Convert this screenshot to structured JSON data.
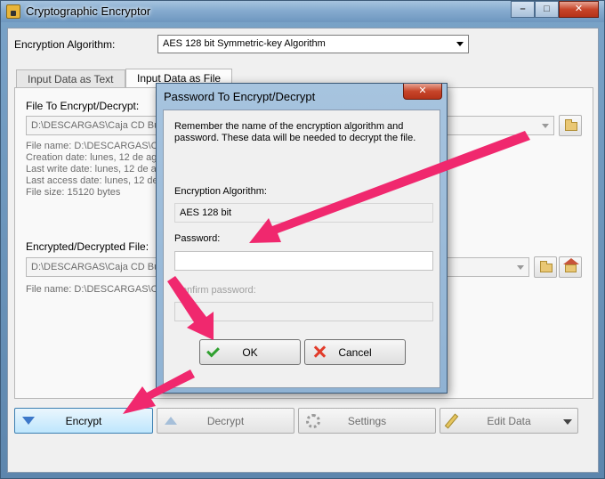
{
  "window": {
    "title": "Cryptographic Encryptor",
    "minimize": "–",
    "maximize": "□",
    "close": "✕"
  },
  "top": {
    "algorithm_label": "Encryption Algorithm:",
    "algorithm_value": "AES 128 bit Symmetric-key Algorithm"
  },
  "tabs": [
    {
      "label": "Input Data as Text",
      "active": false
    },
    {
      "label": "Input Data as File",
      "active": true
    }
  ],
  "source": {
    "label": "File To Encrypt/Decrypt:",
    "path": "D:\\DESCARGAS\\Caja CD Bur",
    "info": [
      "File name: D:\\DESCARGAS\\Caj",
      "Creation date: lunes, 12 de ago",
      "Last write date: lunes, 12 de ag",
      "Last access date: lunes, 12 de",
      "File size: 15120 bytes"
    ]
  },
  "dest": {
    "label": "Encrypted/Decrypted File:",
    "path": "D:\\DESCARGAS\\Caja CD Bur",
    "info": "File name: D:\\DESCARGAS\\Ca"
  },
  "buttons": {
    "encrypt": "Encrypt",
    "decrypt": "Decrypt",
    "settings": "Settings",
    "edit_data": "Edit Data"
  },
  "dialog": {
    "title": "Password To Encrypt/Decrypt",
    "close": "✕",
    "note_line1": "Remember the name of the encryption algorithm and",
    "note_line2": "password. These data will be needed to decrypt the file.",
    "algorithm_label": "Encryption Algorithm:",
    "algorithm_value": "AES 128 bit",
    "password_label": "Password:",
    "password_value": "",
    "confirm_label": "Confirm password:",
    "confirm_value": "",
    "ok": "OK",
    "cancel": "Cancel"
  },
  "colors": {
    "annotation_arrow": "#f0286e",
    "accent_blue": "#3d78c9"
  }
}
